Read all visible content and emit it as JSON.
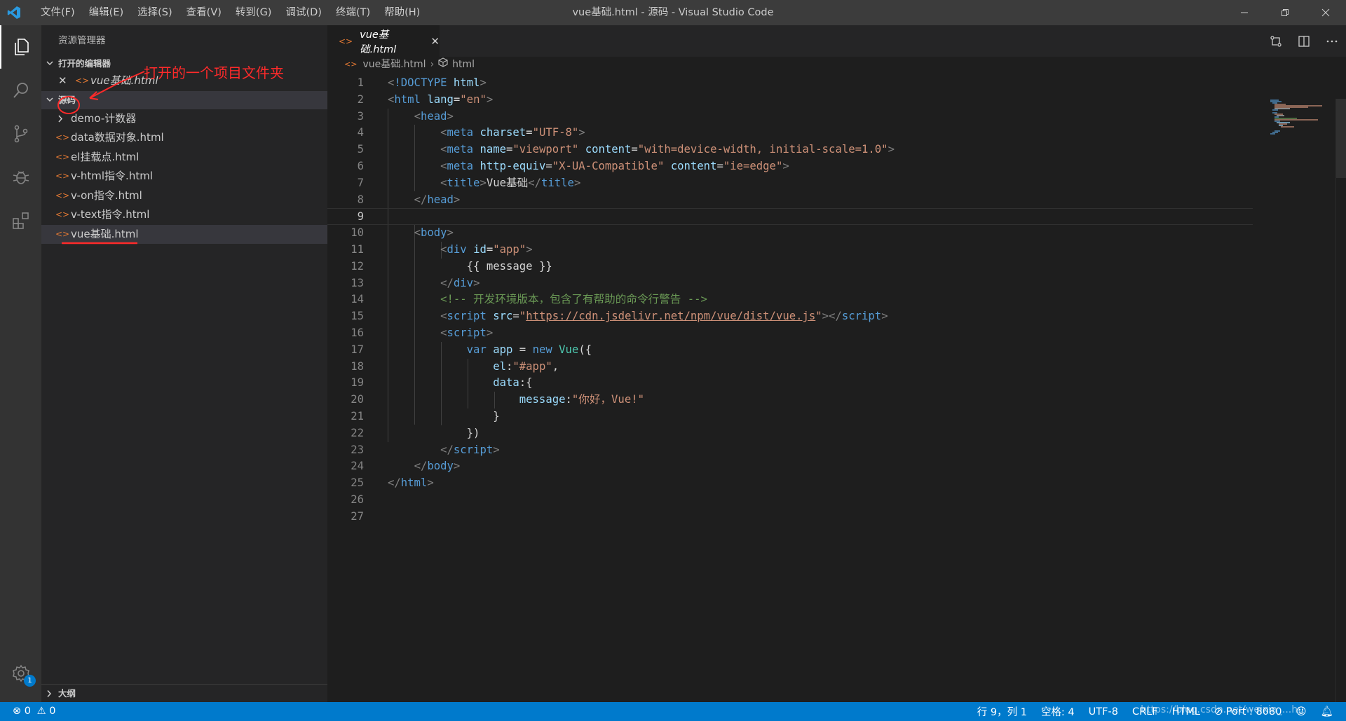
{
  "window": {
    "title": "vue基础.html - 源码 - Visual Studio Code",
    "menu": [
      "文件(F)",
      "编辑(E)",
      "选择(S)",
      "查看(V)",
      "转到(G)",
      "调试(D)",
      "终端(T)",
      "帮助(H)"
    ]
  },
  "activitybar": {
    "icons": [
      "files-icon",
      "search-icon",
      "source-control-icon",
      "debug-icon",
      "extensions-icon"
    ],
    "settings_badge": "1"
  },
  "sidebar": {
    "title": "资源管理器",
    "open_editors_label": "打开的编辑器",
    "open_editor_file": "vue基础.html",
    "folder_label": "源码",
    "folder_items": [
      {
        "label": "demo-计数器",
        "type": "folder"
      },
      {
        "label": "data数据对象.html",
        "type": "file"
      },
      {
        "label": "el挂载点.html",
        "type": "file"
      },
      {
        "label": "v-html指令.html",
        "type": "file"
      },
      {
        "label": "v-on指令.html",
        "type": "file"
      },
      {
        "label": "v-text指令.html",
        "type": "file"
      },
      {
        "label": "vue基础.html",
        "type": "file",
        "selected": true
      }
    ],
    "outline_label": "大纲",
    "annotation": "打开的一个项目文件夹"
  },
  "editor": {
    "tab_label": "vue基础.html",
    "breadcrumb": [
      "vue基础.html",
      "html"
    ],
    "current_line": 9,
    "line_count": 27
  },
  "statusbar": {
    "errors": "0",
    "warnings": "0",
    "position": "行 9，列 1",
    "spaces": "空格: 4",
    "encoding": "UTF-8",
    "eol": "CRLF",
    "language": "HTML",
    "port": "Port : 8080",
    "watermark": "https://blog.csdn.net/weixin_...hu"
  },
  "colors": {
    "accent": "#007acc",
    "annotation": "#ff2a2a"
  }
}
